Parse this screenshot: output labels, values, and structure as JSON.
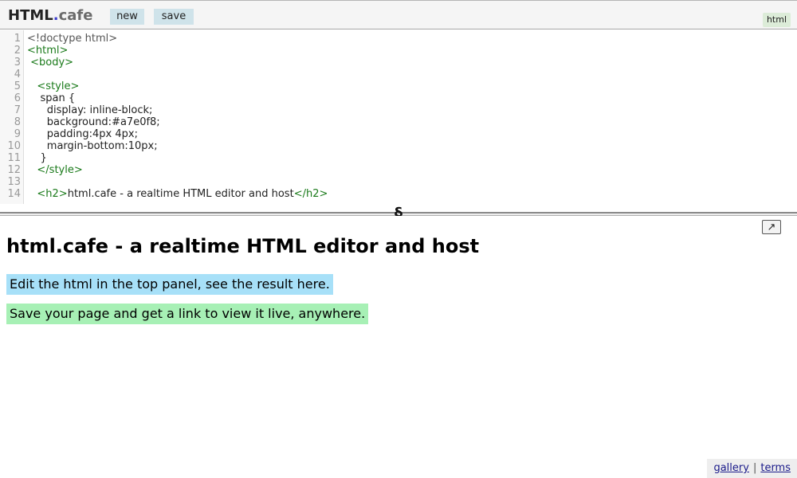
{
  "header": {
    "brand": "HTML",
    "dot": ".",
    "tld": "cafe",
    "new_label": "new",
    "save_label": "save",
    "mode": "html"
  },
  "editor": {
    "lines": [
      {
        "num": "1",
        "parts": [
          {
            "t": "<!doctype html>",
            "c": "muted"
          }
        ]
      },
      {
        "num": "2",
        "parts": [
          {
            "t": "<html>",
            "c": "tag"
          }
        ]
      },
      {
        "num": "3",
        "parts": [
          {
            "t": " <body>",
            "c": "tag"
          }
        ]
      },
      {
        "num": "4",
        "parts": []
      },
      {
        "num": "5",
        "parts": [
          {
            "t": "   <style>",
            "c": "tag"
          }
        ]
      },
      {
        "num": "6",
        "parts": [
          {
            "t": "    span {",
            "c": "plain"
          }
        ]
      },
      {
        "num": "7",
        "parts": [
          {
            "t": "      display: inline-block;",
            "c": "plain"
          }
        ]
      },
      {
        "num": "8",
        "parts": [
          {
            "t": "      background:#a7e0f8;",
            "c": "plain"
          }
        ]
      },
      {
        "num": "9",
        "parts": [
          {
            "t": "      padding:4px 4px;",
            "c": "plain"
          }
        ]
      },
      {
        "num": "10",
        "parts": [
          {
            "t": "      margin-bottom:10px;",
            "c": "plain"
          }
        ]
      },
      {
        "num": "11",
        "parts": [
          {
            "t": "    }",
            "c": "plain"
          }
        ]
      },
      {
        "num": "12",
        "parts": [
          {
            "t": "   </style>",
            "c": "tag"
          }
        ]
      },
      {
        "num": "13",
        "parts": []
      },
      {
        "num": "14",
        "parts": [
          {
            "t": "   <h2>",
            "c": "tag"
          },
          {
            "t": "html.cafe - a realtime HTML editor and host",
            "c": "plain"
          },
          {
            "t": "</h2>",
            "c": "tag"
          }
        ]
      }
    ]
  },
  "divider": {
    "handle": "§"
  },
  "preview": {
    "popout": "↗",
    "title": "html.cafe - a realtime HTML editor and host",
    "line1": "Edit the html in the top panel, see the result here.",
    "line2": "Save your page and get a link to view it live, anywhere."
  },
  "footer": {
    "gallery": "gallery",
    "sep": "|",
    "terms": "terms"
  },
  "colors": {
    "tag": "#1a7a1a",
    "span_blue": "#a7e0f8",
    "span_green": "#a7f0b5",
    "button_bg": "#cfe3ea"
  },
  "icons": {
    "drag_handle": "section-sign-icon",
    "popout": "popout-arrow-icon"
  }
}
